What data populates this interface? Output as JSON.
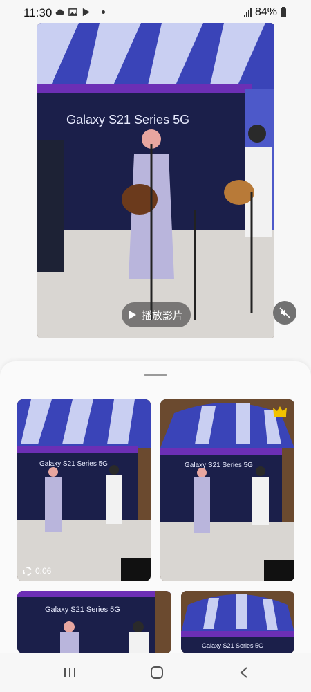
{
  "status_bar": {
    "time": "11:30",
    "battery": "84%"
  },
  "viewer": {
    "play_label": "播放影片",
    "banner_text": "Galaxy S21 Series 5G"
  },
  "thumbnails": [
    {
      "banner_text": "Galaxy S21 Series 5G",
      "duration": "0:06"
    },
    {
      "banner_text": "Galaxy S21 Series 5G"
    },
    {
      "banner_text": "Galaxy S21 Series 5G"
    },
    {
      "banner_text": "Galaxy S21 Series 5G"
    }
  ],
  "colors": {
    "crown": "#f2c200",
    "tent_blue": "#3a44b8",
    "backdrop_navy": "#1b1f4a"
  }
}
